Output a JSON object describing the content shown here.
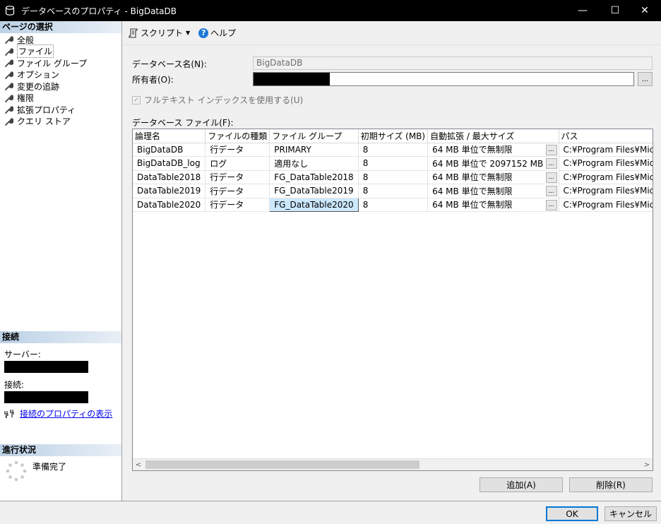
{
  "window": {
    "title": "データベースのプロパティ - BigDataDB",
    "minimize_glyph": "—",
    "maximize_glyph": "☐",
    "close_glyph": "✕"
  },
  "left": {
    "pages_header": "ページの選択",
    "pages": [
      {
        "label": "全般",
        "icon": "wrench-icon"
      },
      {
        "label": "ファイル",
        "icon": "wrench-icon",
        "selected": true
      },
      {
        "label": "ファイル グループ",
        "icon": "wrench-icon"
      },
      {
        "label": "オプション",
        "icon": "wrench-icon"
      },
      {
        "label": "変更の追跡",
        "icon": "wrench-icon"
      },
      {
        "label": "権限",
        "icon": "wrench-icon"
      },
      {
        "label": "拡張プロパティ",
        "icon": "wrench-icon"
      },
      {
        "label": "クエリ ストア",
        "icon": "wrench-icon"
      }
    ],
    "connection_header": "接続",
    "server_label": "サーバー:",
    "connection_label": "接続:",
    "connection_link": "接続のプロパティの表示",
    "progress_header": "進行状況",
    "progress_status": "準備完了"
  },
  "toolbar": {
    "script_label": "スクリプト",
    "help_label": "ヘルプ",
    "help_glyph": "?",
    "dropdown_glyph": "▼"
  },
  "form": {
    "dbname_label": "データベース名(N):",
    "dbname_value": "BigDataDB",
    "owner_label": "所有者(O):",
    "owner_browse": "...",
    "fulltext_label": "フルテキスト インデックスを使用する(U)",
    "fulltext_checked": true,
    "check_glyph": "✓",
    "files_label": "データベース ファイル(F):"
  },
  "grid": {
    "columns": [
      "論理名",
      "ファイルの種類",
      "ファイル グループ",
      "初期サイズ (MB)",
      "自動拡張 / 最大サイズ",
      "パス"
    ],
    "rows": [
      [
        "BigDataDB",
        "行データ",
        "PRIMARY",
        "8",
        "64 MB 単位で無制限",
        "C:¥Program Files¥Microsoft"
      ],
      [
        "BigDataDB_log",
        "ログ",
        "適用なし",
        "8",
        "64 MB 単位で 2097152 MB ...",
        "C:¥Program Files¥Microsoft"
      ],
      [
        "DataTable2018",
        "行データ",
        "FG_DataTable2018",
        "8",
        "64 MB 単位で無制限",
        "C:¥Program Files¥Microsoft"
      ],
      [
        "DataTable2019",
        "行データ",
        "FG_DataTable2019",
        "8",
        "64 MB 単位で無制限",
        "C:¥Program Files¥Microsoft"
      ],
      [
        "DataTable2020",
        "行データ",
        "FG_DataTable2020",
        "8",
        "64 MB 単位で無制限",
        "C:¥Program Files¥Microsoft"
      ]
    ],
    "selected_row": 4,
    "selected_col": 2,
    "cell_browse": "...",
    "scroll_left_glyph": "<",
    "scroll_right_glyph": ">"
  },
  "buttons": {
    "add": "追加(A)",
    "remove": "削除(R)",
    "ok": "OK",
    "cancel": "キャンセル"
  }
}
